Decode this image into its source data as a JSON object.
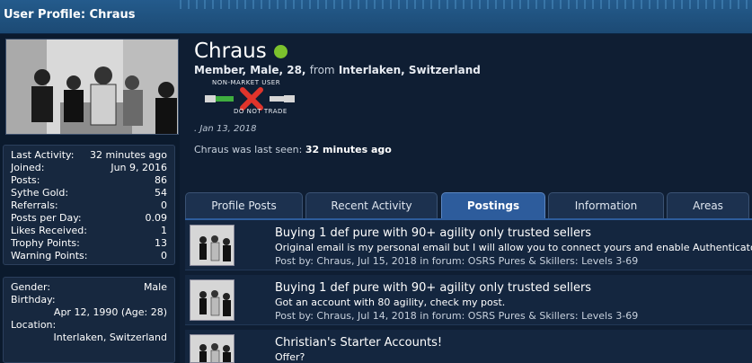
{
  "page": {
    "title": "User Profile: Chraus"
  },
  "profile": {
    "username": "Chraus",
    "member_info": "Member, Male, 28,",
    "from_label": "from",
    "location": "Interlaken, Switzerland",
    "badge_top": "NON-MARKET USER",
    "badge_bottom": "DO NOT TRADE",
    "joined_date": ". Jan 13, 2018",
    "last_seen_prefix": "Chraus was last seen:",
    "last_seen_value": "32 minutes ago"
  },
  "stats": [
    {
      "label": "Last Activity:",
      "value": "32 minutes ago"
    },
    {
      "label": "Joined:",
      "value": "Jun 9, 2016"
    },
    {
      "label": "Posts:",
      "value": "86"
    },
    {
      "label": "Sythe Gold:",
      "value": "54"
    },
    {
      "label": "Referrals:",
      "value": "0"
    },
    {
      "label": "Posts per Day:",
      "value": "0.09"
    },
    {
      "label": "Likes Received:",
      "value": "1"
    },
    {
      "label": "Trophy Points:",
      "value": "13"
    },
    {
      "label": "Warning Points:",
      "value": "0"
    }
  ],
  "details": {
    "gender_label": "Gender:",
    "gender_value": "Male",
    "birthday_label": "Birthday:",
    "birthday_value": "Apr 12, 1990 (Age: 28)",
    "location_label": "Location:",
    "location_value": "Interlaken, Switzerland"
  },
  "tabs": [
    {
      "label": "Profile Posts"
    },
    {
      "label": "Recent Activity"
    },
    {
      "label": "Postings"
    },
    {
      "label": "Information"
    },
    {
      "label": "Areas"
    }
  ],
  "posts": [
    {
      "title": "Buying 1 def pure with 90+ agility only trusted sellers",
      "snippet": "Original email is my personal email but I will allow you to connect yours and enable Authenticator",
      "meta": "Post by: Chraus, Jul 15, 2018 in forum: OSRS Pures & Skillers: Levels 3-69"
    },
    {
      "title": "Buying 1 def pure with 90+ agility only trusted sellers",
      "snippet": "Got an account with 80 agility, check my post.",
      "meta": "Post by: Chraus, Jul 14, 2018 in forum: OSRS Pures & Skillers: Levels 3-69"
    },
    {
      "title": "Christian's Starter Accounts!",
      "snippet": "Offer?",
      "meta": ""
    }
  ],
  "colors": {
    "header": "#245b8c",
    "background": "#0f1e33",
    "active_tab": "#2d5c9c",
    "online": "#7cc22d",
    "dnt_red": "#e0342b",
    "dnt_green": "#3fae3f"
  }
}
